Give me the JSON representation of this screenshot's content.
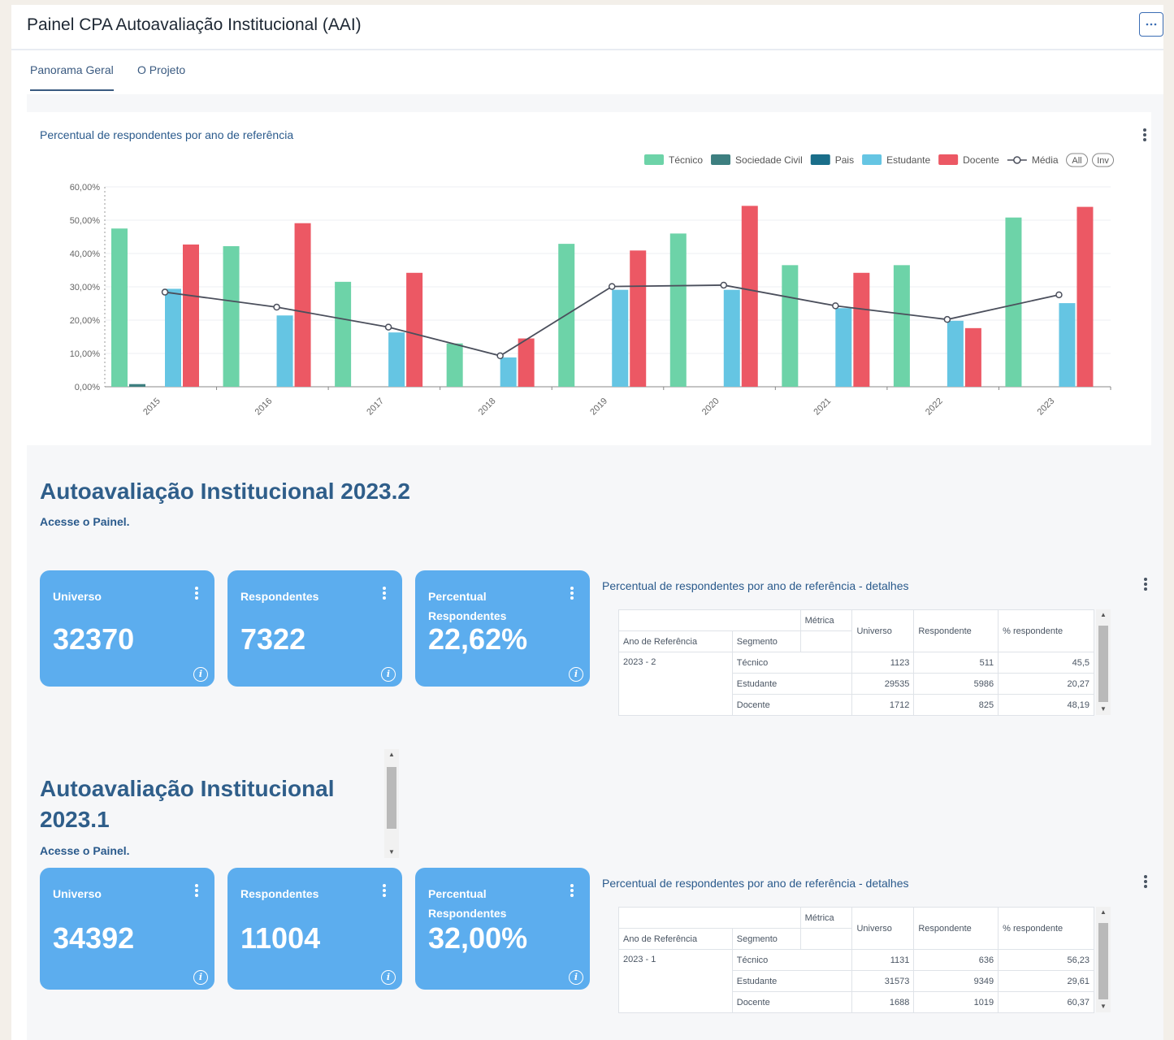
{
  "header": {
    "title": "Painel CPA Autoavaliação Institucional (AAI)",
    "more_icon": "ellipsis-icon"
  },
  "tabs": [
    {
      "label": "Panorama Geral",
      "active": true
    },
    {
      "label": "O Projeto",
      "active": false
    }
  ],
  "main_chart": {
    "title": "Percentual de respondentes por ano de referência",
    "legend_all": "All",
    "legend_inv": "Inv",
    "chart_data": {
      "type": "bar",
      "title": "Percentual de respondentes por ano de referência",
      "categories": [
        "2015",
        "2016",
        "2017",
        "2018",
        "2019",
        "2020",
        "2021",
        "2022",
        "2023"
      ],
      "series": [
        {
          "name": "Técnico",
          "color": "#6dd3a8",
          "values": [
            47.5,
            42.2,
            31.5,
            13.0,
            42.9,
            46.0,
            36.5,
            36.5,
            50.8
          ]
        },
        {
          "name": "Sociedade Civil",
          "color": "#3d7f80",
          "values": [
            0.8,
            0,
            0,
            0,
            0,
            0,
            0,
            0,
            0
          ]
        },
        {
          "name": "Pais",
          "color": "#1a6e8a",
          "values": [
            0,
            0,
            0,
            0,
            0,
            0,
            0,
            0,
            0
          ]
        },
        {
          "name": "Estudante",
          "color": "#65c5e3",
          "values": [
            29.4,
            21.4,
            16.3,
            8.8,
            29.1,
            29.1,
            23.6,
            19.8,
            25.1
          ]
        },
        {
          "name": "Docente",
          "color": "#ec5864",
          "values": [
            42.7,
            49.1,
            34.2,
            14.5,
            40.9,
            54.3,
            34.2,
            17.6,
            54.0
          ]
        }
      ],
      "line": {
        "name": "Média",
        "color": "#4b4f5c",
        "values": [
          28.4,
          23.9,
          17.9,
          9.3,
          30.1,
          30.5,
          24.3,
          20.2,
          27.6
        ]
      },
      "ylim": [
        0,
        60
      ],
      "yticks": [
        "0,00%",
        "10,00%",
        "20,00%",
        "30,00%",
        "40,00%",
        "50,00%",
        "60,00%"
      ],
      "legend_position": "top-right",
      "grid": true
    }
  },
  "sections": [
    {
      "title": "Autoavaliação Institucional 2023.2",
      "link": "Acesse o Painel.",
      "cards": [
        {
          "label": "Universo",
          "value": "32370"
        },
        {
          "label": "Respondentes",
          "value": "7322"
        },
        {
          "label": "Percentual Respondentes",
          "value": "22,62%"
        }
      ],
      "table_title": "Percentual de respondentes por ano de referência - detalhes",
      "table": {
        "metric_header": "Métrica",
        "row_headers": [
          "Ano de Referência",
          "Segmento"
        ],
        "columns": [
          "Universo",
          "Respondente",
          "% respondente"
        ],
        "period": "2023 - 2",
        "rows": [
          {
            "segment": "Técnico",
            "universo": "1123",
            "respondente": "511",
            "pct": "45,5"
          },
          {
            "segment": "Estudante",
            "universo": "29535",
            "respondente": "5986",
            "pct": "20,27"
          },
          {
            "segment": "Docente",
            "universo": "1712",
            "respondente": "825",
            "pct": "48,19"
          }
        ]
      }
    },
    {
      "title": "Autoavaliação Institucional 2023.1",
      "link": "Acesse o Painel.",
      "cards": [
        {
          "label": "Universo",
          "value": "34392"
        },
        {
          "label": "Respondentes",
          "value": "11004"
        },
        {
          "label": "Percentual Respondentes",
          "value": "32,00%"
        }
      ],
      "table_title": "Percentual de respondentes por ano de referência - detalhes",
      "table": {
        "metric_header": "Métrica",
        "row_headers": [
          "Ano de Referência",
          "Segmento"
        ],
        "columns": [
          "Universo",
          "Respondente",
          "% respondente"
        ],
        "period": "2023 - 1",
        "rows": [
          {
            "segment": "Técnico",
            "universo": "1131",
            "respondente": "636",
            "pct": "56,23"
          },
          {
            "segment": "Estudante",
            "universo": "31573",
            "respondente": "9349",
            "pct": "29,61"
          },
          {
            "segment": "Docente",
            "universo": "1688",
            "respondente": "1019",
            "pct": "60,37"
          }
        ]
      }
    }
  ]
}
